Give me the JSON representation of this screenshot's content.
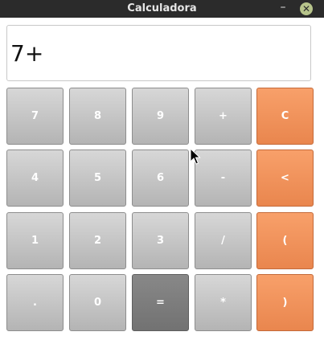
{
  "window": {
    "title": "Calculadora",
    "minimize_glyph": "–",
    "close_glyph": "✕"
  },
  "display": {
    "value": "7+"
  },
  "keys": {
    "r1": [
      "7",
      "8",
      "9",
      "+",
      "C"
    ],
    "r2": [
      "4",
      "5",
      "6",
      "-",
      "<"
    ],
    "r3": [
      "1",
      "2",
      "3",
      "/",
      "("
    ],
    "r4": [
      ".",
      "0",
      "=",
      "*",
      ")"
    ]
  },
  "colors": {
    "key_gray": "#c6c6c6",
    "key_orange": "#f09458",
    "key_equals": "#7d7d7d",
    "titlebar": "#2b2b2b"
  },
  "icons": {
    "close": "close-icon",
    "minimize": "minimize-icon",
    "cursor": "mouse-pointer-icon"
  }
}
